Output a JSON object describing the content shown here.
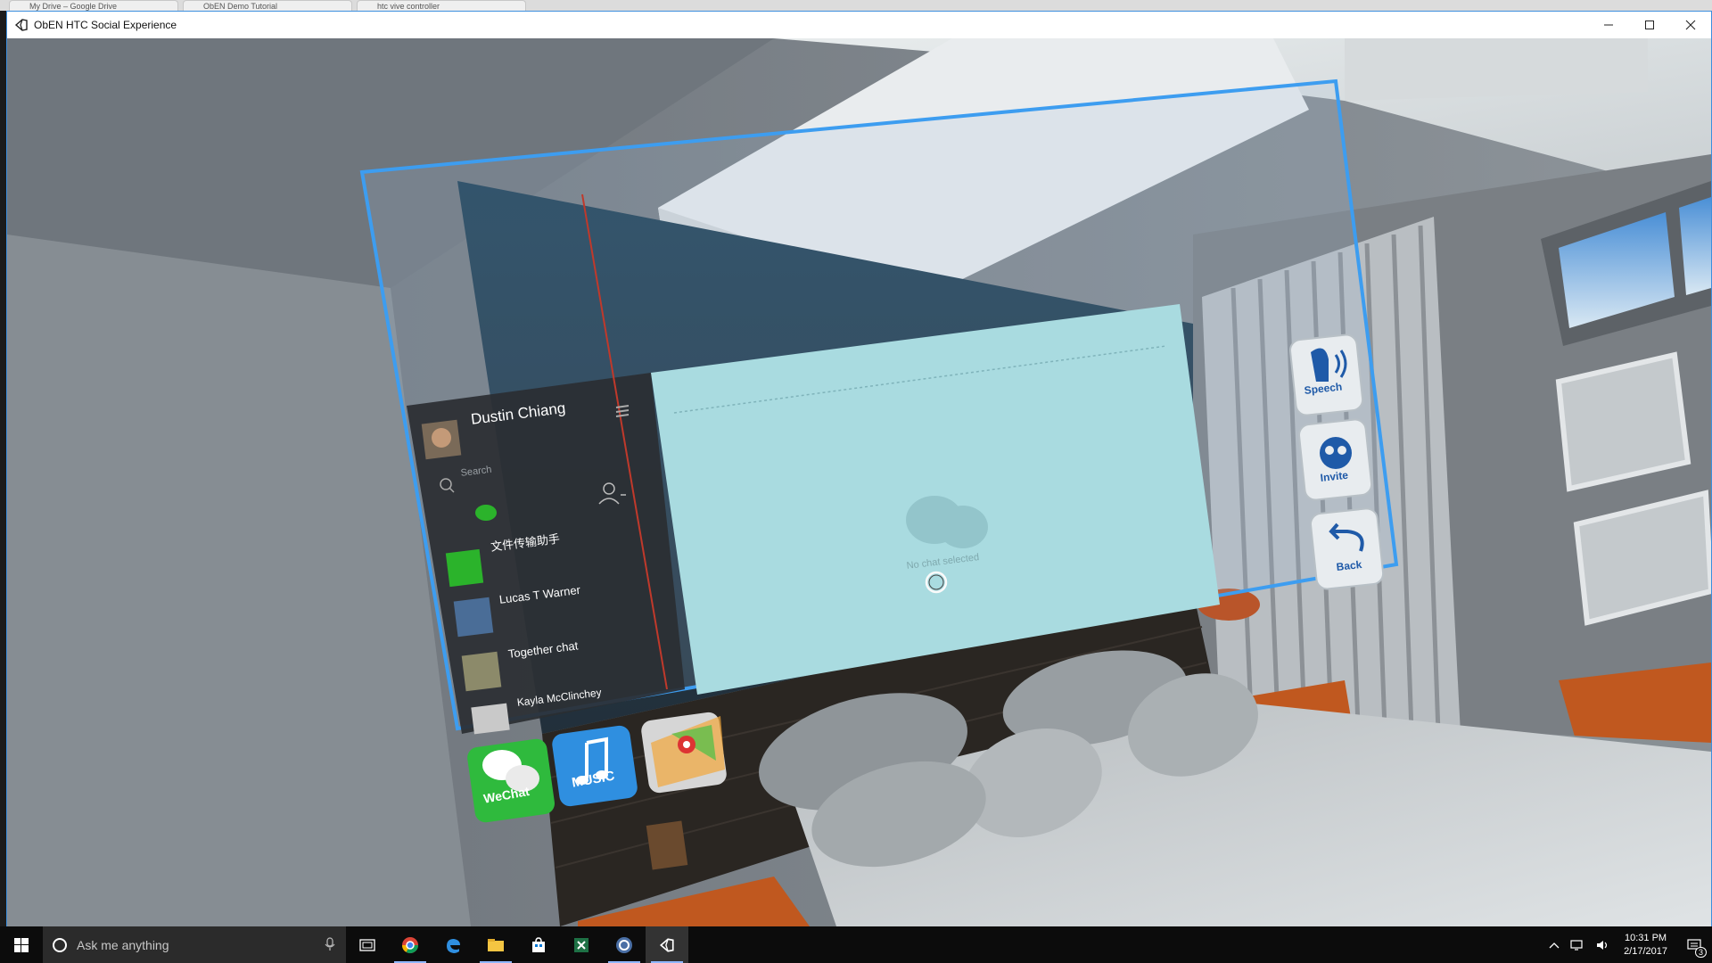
{
  "browser_tabs": [
    {
      "label": "My Drive – Google Drive"
    },
    {
      "label": "ObEN Demo Tutorial"
    },
    {
      "label": "htc vive controller"
    }
  ],
  "window": {
    "title": "ObEN HTC Social Experience"
  },
  "wechat_panel": {
    "user_name": "Dustin Chiang",
    "search_placeholder": "Search",
    "contacts": [
      {
        "name": "文件传输助手"
      },
      {
        "name": "Lucas T Warner"
      },
      {
        "name": "Together chat"
      },
      {
        "name": "Kayla McClinchey"
      }
    ],
    "empty_state": "No chat selected"
  },
  "app_dock": [
    {
      "label": "WeChat",
      "icon": "wechat-icon"
    },
    {
      "label": "MUSIC",
      "icon": "music-note-icon"
    },
    {
      "label": "",
      "icon": "maps-icon"
    }
  ],
  "side_buttons": [
    {
      "label": "Speech",
      "icon": "speech-icon"
    },
    {
      "label": "Invite",
      "icon": "invite-icon"
    },
    {
      "label": "Back",
      "icon": "back-arrow-icon"
    }
  ],
  "taskbar": {
    "search_placeholder": "Ask me anything",
    "apps": [
      {
        "name": "task-view-icon"
      },
      {
        "name": "chrome-icon"
      },
      {
        "name": "edge-icon"
      },
      {
        "name": "file-explorer-icon"
      },
      {
        "name": "store-icon"
      },
      {
        "name": "excel-icon"
      },
      {
        "name": "steam-vr-icon"
      },
      {
        "name": "unity-icon"
      }
    ],
    "time": "10:31 PM",
    "date": "2/17/2017",
    "notifications_count": "3"
  },
  "colors": {
    "selection_frame": "#3d9df0",
    "chat_area": "#a9dbe0",
    "wechat_green": "#2bb32b",
    "taskbar_bg": "#0c0c0c"
  }
}
